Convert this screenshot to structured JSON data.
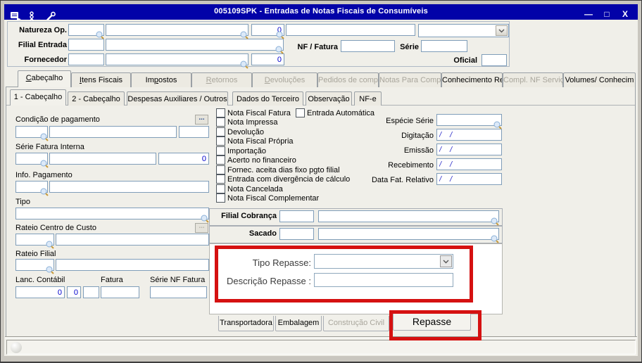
{
  "window": {
    "title": "005109SPK - Entradas de Notas Fiscais de Consumíveis",
    "controls": {
      "minimize": "—",
      "maximize": "□",
      "close": "X"
    }
  },
  "header": {
    "natureza_label": "Natureza Op.",
    "filial_label": "Filial Entrada",
    "fornecedor_label": "Fornecedor",
    "nf_fatura_label": "NF / Fatura",
    "serie_label": "Série",
    "oficial_label": "Oficial",
    "natureza_qty": "0",
    "fornecedor_qty": "0"
  },
  "tabs_main": [
    {
      "label": "Cabeçalho",
      "accel": "0",
      "state": "active"
    },
    {
      "label": "Itens Fiscais",
      "accel": "0",
      "state": "normal"
    },
    {
      "label": "Impostos",
      "accel": "2",
      "state": "normal"
    },
    {
      "label": "Retornos",
      "accel": "0",
      "state": "disabled"
    },
    {
      "label": "Devoluções",
      "accel": "0",
      "state": "disabled"
    },
    {
      "label": "Pedidos de compr",
      "state": "disabled"
    },
    {
      "label": "Notas Para Comp",
      "state": "disabled"
    },
    {
      "label": "Conhecimento Re",
      "state": "normal"
    },
    {
      "label": "Compl. NF Serviç",
      "state": "disabled"
    },
    {
      "label": "Volumes/ Conhecim",
      "state": "normal"
    }
  ],
  "tabs_sub": [
    "1 - Cabeçalho",
    "2 - Cabeçalho",
    "Despesas Auxiliares / Outros",
    "Dados do Terceiro",
    "Observação",
    "NF-e"
  ],
  "left": {
    "cond_label": "Condição de pagamento",
    "dots": "...",
    "serie_fatura_label": "Série Fatura Interna",
    "serie_fatura_qty": "0",
    "info_label": "Info. Pagamento",
    "tipo_label": "Tipo",
    "rateio_cc_label": "Rateio Centro de Custo",
    "rateio_filial_label": "Rateio Filial",
    "lanc_label": "Lanc. Contábil",
    "fatura_label": "Fatura",
    "serie_nf_label": "Série NF Fatura",
    "lanc_val1": "0",
    "lanc_val2": "0"
  },
  "checkboxes": [
    "Nota Fiscal Fatura",
    "Nota Impressa",
    "Devolução",
    "Nota Fiscal Própria",
    "Importação",
    "Acerto no financeiro",
    "Fornec. aceita dias fixo pgto filial",
    "Entrada com divergência de cálculo",
    "Nota Cancelada",
    "Nota Fiscal Complementar"
  ],
  "entrada_automatica_label": "Entrada Automática",
  "right": {
    "especie_label": "Espécie Série",
    "digitacao_label": "Digitação",
    "emissao_label": "Emissão",
    "recebimento_label": "Recebimento",
    "data_fat_label": "Data Fat. Relativo",
    "date_placeholder": "/  /"
  },
  "billing": {
    "filial_cobranca_label": "Filial Cobrança",
    "sacado_label": "Sacado"
  },
  "repasse": {
    "tipo_label": "Tipo Repasse:",
    "descricao_label": "Descrição Repasse :"
  },
  "tabs_bottom": [
    {
      "label": "Transportadora",
      "state": "normal"
    },
    {
      "label": "Embalagem",
      "state": "normal"
    },
    {
      "label": "Construção Civil",
      "state": "disabled"
    },
    {
      "label": "Repasse",
      "state": "active"
    }
  ],
  "colors": {
    "annotation_red": "#d51111",
    "titlebar_blue": "#0202a8",
    "value_blue": "#0000cc"
  }
}
